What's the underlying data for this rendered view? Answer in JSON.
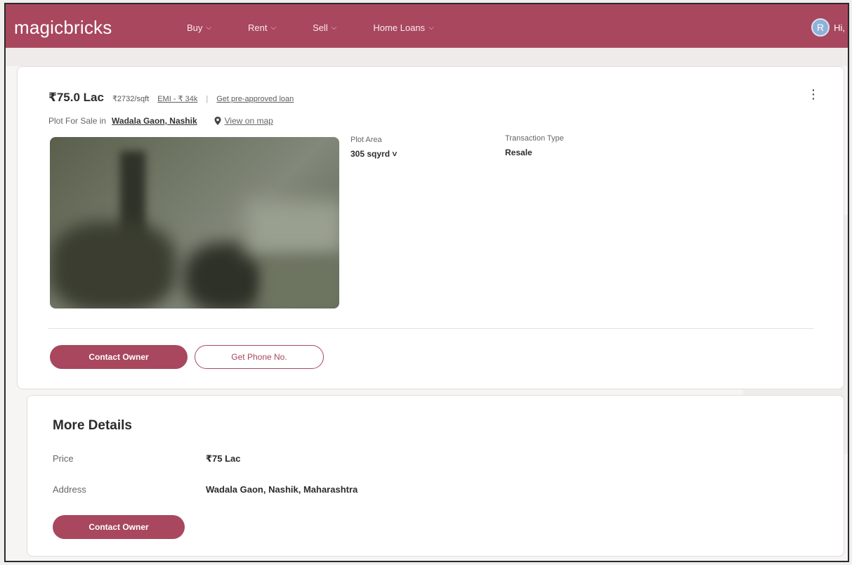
{
  "header": {
    "logo": "magicbricks",
    "nav": [
      {
        "label": "Buy"
      },
      {
        "label": "Rent"
      },
      {
        "label": "Sell"
      },
      {
        "label": "Home Loans"
      }
    ],
    "user_initial": "R",
    "user_greeting": "Hi,"
  },
  "listing": {
    "price": "₹75.0 Lac",
    "price_per_unit": "₹2732/sqft",
    "emi_link": "EMI - ₹ 34k",
    "separator": "|",
    "loan_link": "Get pre-approved loan",
    "subtitle_prefix": "Plot For Sale in",
    "location": "Wadala Gaon, Nashik",
    "map_link": "View on map",
    "attributes": [
      {
        "label": "Plot Area",
        "value": "305 sqyrd ˅"
      },
      {
        "label": "Transaction Type",
        "value": "Resale"
      }
    ],
    "contact_button": "Contact Owner",
    "phone_button": "Get Phone No."
  },
  "more_details": {
    "title": "More Details",
    "rows": [
      {
        "label": "Price",
        "value": "₹75 Lac"
      },
      {
        "label": "Address",
        "value": "Wadala Gaon, Nashik, Maharashtra"
      }
    ],
    "contact_button": "Contact Owner"
  },
  "colors": {
    "brand": "#a8475e"
  }
}
